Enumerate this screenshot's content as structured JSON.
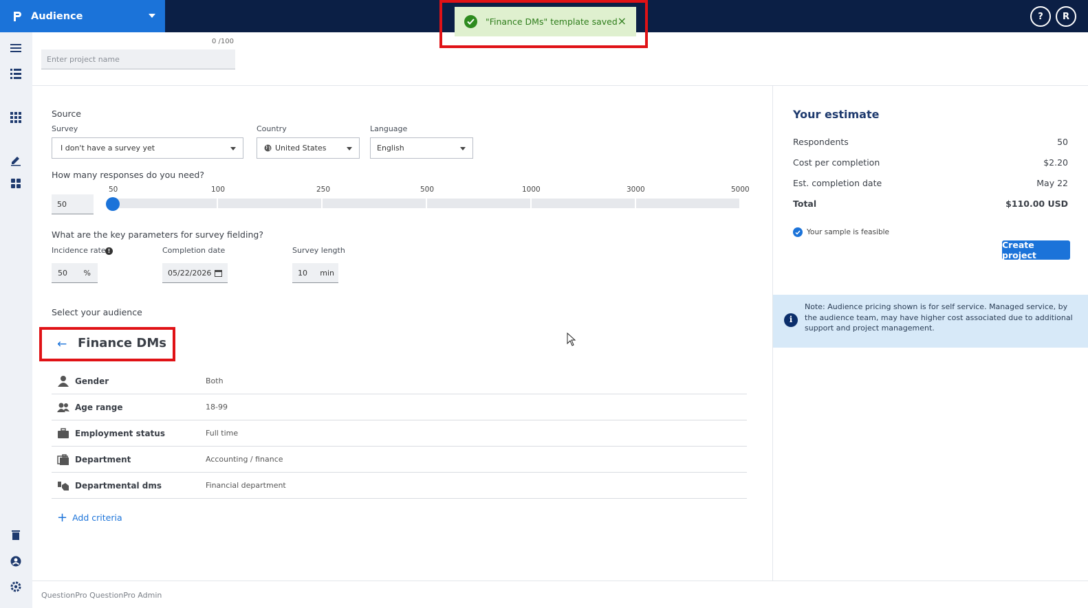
{
  "header": {
    "app_title": "Audience",
    "help_label": "?",
    "user_initial": "R"
  },
  "toast": {
    "message": "\"Finance DMs\" template saved",
    "close": "×"
  },
  "project": {
    "name_placeholder": "Enter project name",
    "counter": "0 /100"
  },
  "source": {
    "section_label": "Source",
    "survey_label": "Survey",
    "survey_value": "I don't have a survey yet",
    "country_label": "Country",
    "country_value": "United States",
    "language_label": "Language",
    "language_value": "English"
  },
  "responses": {
    "question": "How many responses do you need?",
    "value": "50",
    "ticks": [
      "50",
      "100",
      "250",
      "500",
      "1000",
      "3000",
      "5000"
    ]
  },
  "fielding": {
    "question": "What are the key parameters for survey fielding?",
    "incidence_label": "Incidence rate",
    "incidence_value": "50",
    "incidence_unit": "%",
    "completion_label": "Completion date",
    "completion_value": "05/22/2026",
    "length_label": "Survey length",
    "length_value": "10",
    "length_unit": "min"
  },
  "audience": {
    "section_label": "Select your audience",
    "template_name": "Finance DMs",
    "criteria": [
      {
        "key": "Gender",
        "value": "Both",
        "icon": "person-icon"
      },
      {
        "key": "Age range",
        "value": "18-99",
        "icon": "people-icon"
      },
      {
        "key": "Employment status",
        "value": "Full time",
        "icon": "briefcase-icon"
      },
      {
        "key": "Department",
        "value": "Accounting / finance",
        "icon": "briefcase-stack-icon"
      },
      {
        "key": "Departmental dms",
        "value": "Financial department",
        "icon": "handshake-icon"
      }
    ],
    "add_label": "Add criteria"
  },
  "estimate": {
    "title": "Your estimate",
    "rows": [
      {
        "label": "Respondents",
        "value": "50"
      },
      {
        "label": "Cost per completion",
        "value": "$2.20"
      },
      {
        "label": "Est. completion date",
        "value": "May 22"
      },
      {
        "label": "Total",
        "value": "$110.00 USD"
      }
    ],
    "feasible": "Your sample is feasible",
    "create_label": "Create project",
    "note": "Note: Audience pricing shown is for self service. Managed service, by the audience team, may have higher cost associated due to additional support and project management."
  },
  "footer": {
    "text": "QuestionPro QuestionPro Admin"
  },
  "colors": {
    "brand": "#1b73d9",
    "topbar": "#0b1f45",
    "toast_bg": "#dff0cf",
    "highlight": "#e01216"
  }
}
